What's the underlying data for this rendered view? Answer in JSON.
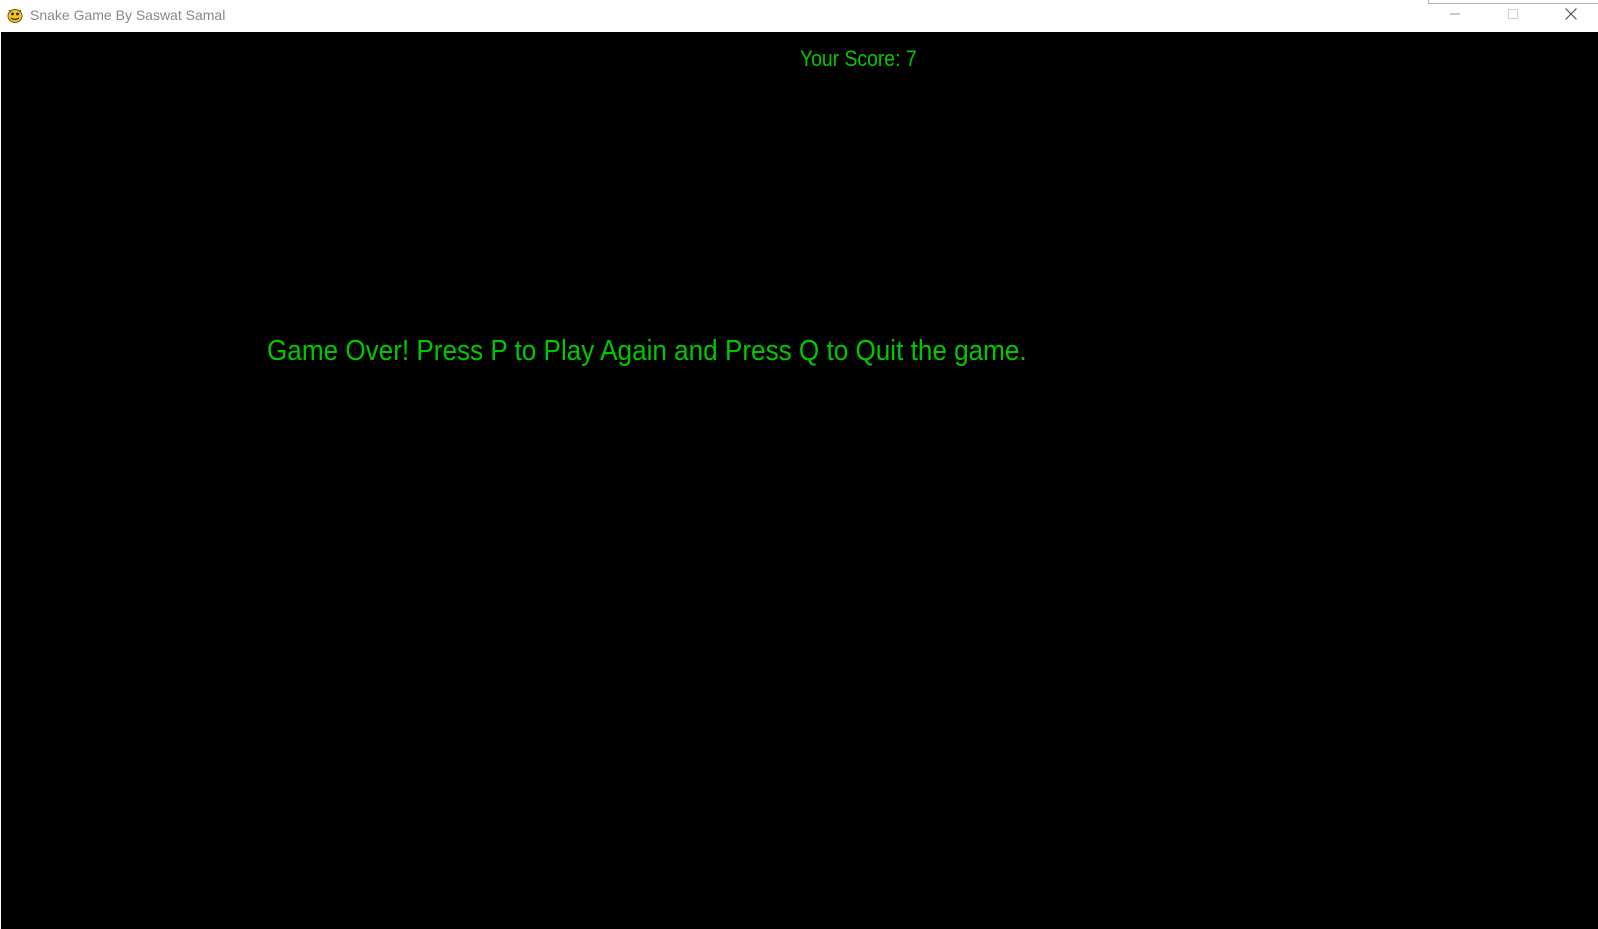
{
  "window": {
    "title": "Snake Game By Saswat Samal",
    "icon": "pygame-snake-icon",
    "buttons": {
      "minimize_icon": "minimize-icon",
      "maximize_icon": "maximize-icon",
      "close_icon": "close-icon"
    }
  },
  "game": {
    "score_text": "Your Score: 7",
    "score": 7,
    "message": "Game Over! Press P to Play Again and Press Q to Quit the game."
  },
  "colors": {
    "background": "#000000",
    "text": "#00c800",
    "titlebar": "#ffffff"
  }
}
